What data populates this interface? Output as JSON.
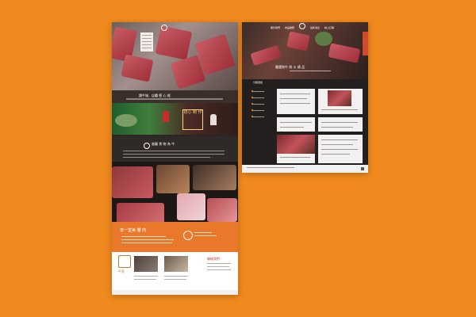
{
  "background_color": "#f08a1e",
  "left_page": {
    "tagline": "讚牛城．店職 堅 心 經",
    "sign_text": "初心 制 作",
    "about_title": "嵐圖 食 物 為 牛",
    "promo_text": "享一堂美 饕 肉",
    "brand_name": "牛家",
    "contact_title": "聯絡我們"
  },
  "right_page": {
    "menu": [
      "關於我們",
      "肉品推薦",
      "最新消息",
      "線上訂購"
    ],
    "caption": "嚴選和牛 與 火 燒 品",
    "sidebar_head": "分類選單",
    "accent": "#d24a2d"
  }
}
